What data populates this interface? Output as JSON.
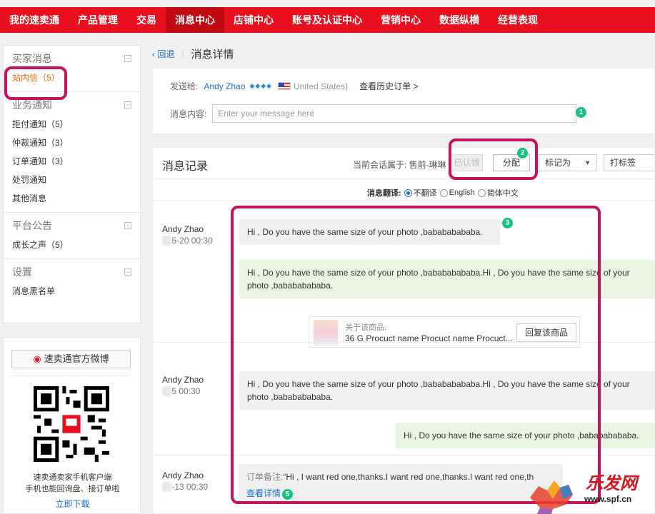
{
  "topnav": {
    "items": [
      "我的速卖通",
      "产品管理",
      "交易",
      "消息中心",
      "店铺中心",
      "账号及认证中心",
      "营销中心",
      "数据纵横",
      "经营表现"
    ],
    "active_index": 3
  },
  "sidebar": {
    "groups": [
      {
        "title": "买家消息",
        "toggle": "−",
        "items": [
          "站内信（5）"
        ]
      },
      {
        "title": "业务通知",
        "toggle": "−",
        "items": [
          "拒付通知（5）",
          "仲裁通知（3）",
          "订单通知（3）",
          "处罚通知",
          "其他消息"
        ]
      },
      {
        "title": "平台公告",
        "toggle": "−",
        "items": [
          "成长之声（5）"
        ]
      },
      {
        "title": "设置",
        "toggle": "−",
        "items": [
          "消息黑名单"
        ]
      }
    ]
  },
  "weibo": {
    "button_label": "速卖通官方微博",
    "line1": "速卖通卖家手机客户端",
    "line2": "手机也能回询盘、接订单啦",
    "download_label": "立即下载"
  },
  "breadcrumb": {
    "back_label": "‹ 回退",
    "sep": "|",
    "title": "消息详情"
  },
  "send": {
    "to_label": "发送给:",
    "recipient": "Andy Zhao",
    "diamonds": "◆◆◆◆",
    "country": "United States)",
    "history_label": "查看历史订单 >",
    "content_label": "消息内容:",
    "placeholder": "Enter your message here"
  },
  "records": {
    "title": "消息记录",
    "owner_text": "当前会话属于: 售前-琳琳",
    "claimed_label": "已认领",
    "assign_label": "分配",
    "mark_label": "标记为",
    "tag_label": "打标签",
    "translate_label": "消息翻译:",
    "translate_options": [
      "不翻译",
      "English",
      "简体中文"
    ],
    "translate_selected": 0
  },
  "messages": [
    {
      "sender": "Andy Zhao",
      "time_prefix": "20",
      "time_suffix": "5-20 00:30",
      "bubble1": "Hi , Do you have the same size of your photo ,babababababa.",
      "bubble2": "Hi , Do you have the same size of your photo ,babababababa.Hi , Do you have the same size of your photo ,babababababa."
    },
    {
      "sender": "Andy Zhao",
      "time_prefix": "20",
      "time_suffix": "5 00:30",
      "bubble1": "Hi , Do you have the same size of your photo ,babababababa.Hi , Do you have the same size of your photo ,babababababa.",
      "reply": "Hi , Do you have the same size of your photo ,babababababa."
    },
    {
      "sender": "Andy Zhao",
      "time_prefix": "20",
      "time_suffix": "-13 00:30"
    }
  ],
  "product": {
    "about_label": "关于该商品:",
    "name": "36 G Procuct name Procuct name Procuct...",
    "reply_label": "回复该商品"
  },
  "note": {
    "label": "订单备注:",
    "text": "“Hi , I want red one,thanks.I want red one,thanks.I want red one,th",
    "link": "查看详情"
  },
  "badges": [
    "1",
    "2",
    "3",
    "5"
  ],
  "watermark": {
    "text": "乐发网",
    "url": "www.spf.cn"
  },
  "colors": {
    "nav_red": "#e8101e",
    "highlight": "#c8125a",
    "link_blue": "#1a6fd1",
    "badge_green": "#16c47f",
    "active_orange": "#ff6a00"
  }
}
